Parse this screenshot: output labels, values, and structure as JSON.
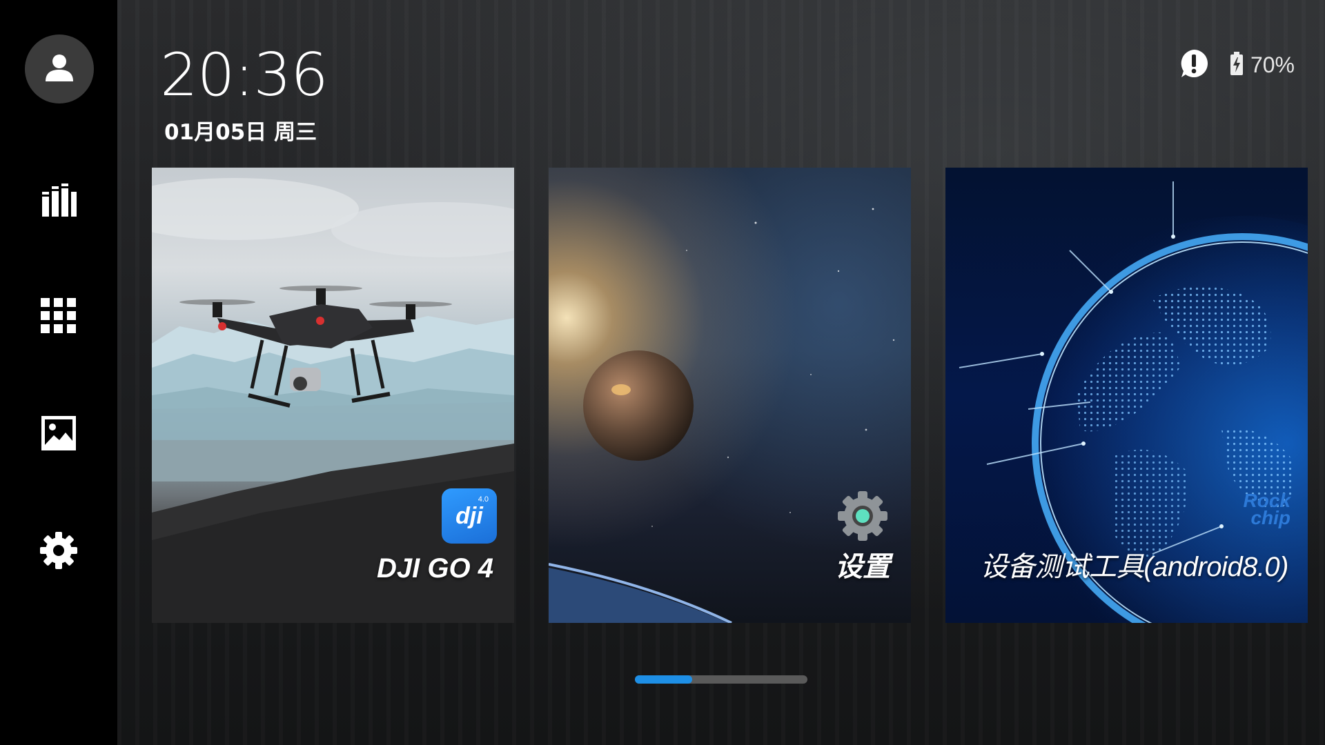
{
  "clock": {
    "time": "20:36",
    "date": "01月05日 周三"
  },
  "status": {
    "alert_icon": "alert-icon",
    "battery_icon": "battery-charging-icon",
    "battery_text": "70%"
  },
  "sidebar": {
    "items": [
      {
        "icon": "user-avatar-icon"
      },
      {
        "icon": "library-icon"
      },
      {
        "icon": "apps-grid-icon"
      },
      {
        "icon": "gallery-icon"
      },
      {
        "icon": "settings-gear-icon"
      }
    ]
  },
  "tiles": [
    {
      "label": "DJI GO 4",
      "badge": "dji",
      "badge_version": "4.0"
    },
    {
      "label": "设置"
    },
    {
      "label": "设备测试工具(android8.0)",
      "watermark": [
        "Rock",
        "chip"
      ]
    }
  ],
  "page_indicator": {
    "pages": 3,
    "current": 1
  },
  "colors": {
    "sidebar": "#000000",
    "accent": "#1e8fe6",
    "dji_badge": "#1f7fe6"
  }
}
